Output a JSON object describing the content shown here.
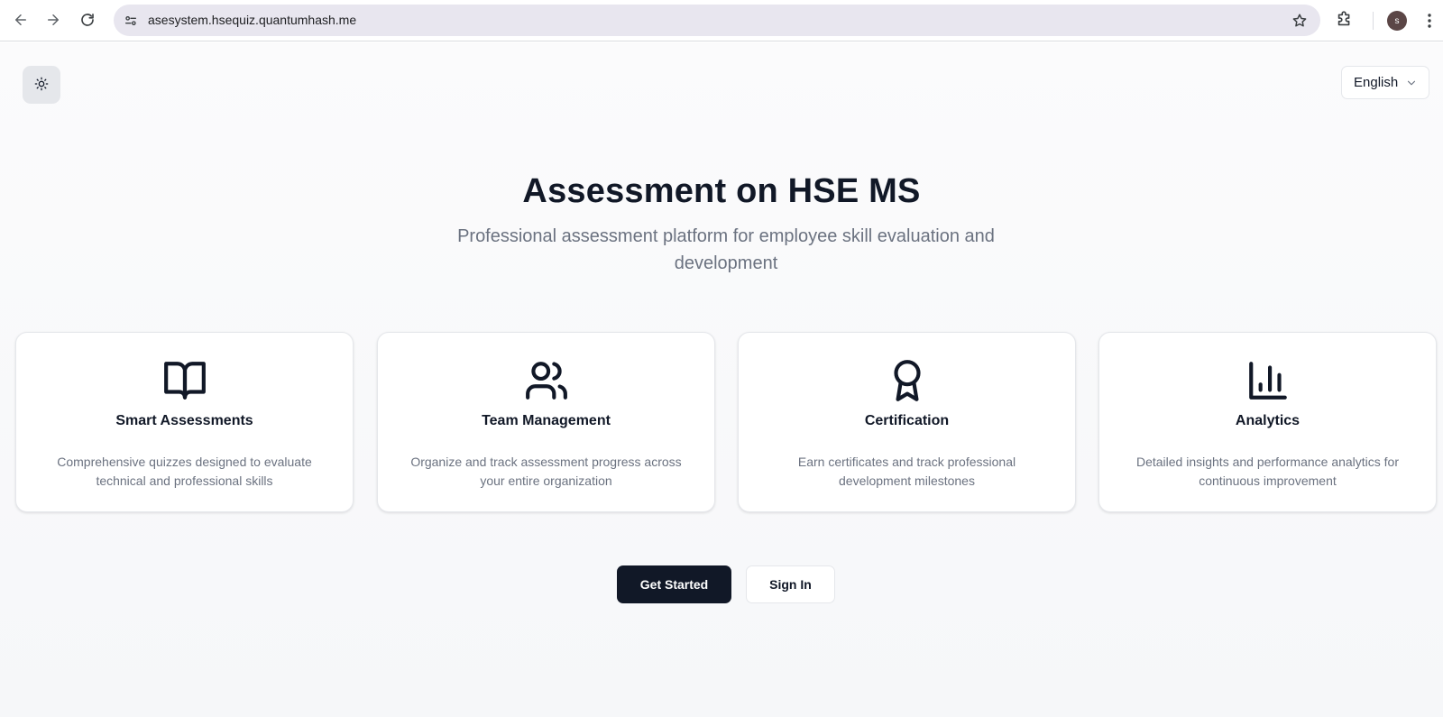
{
  "browser": {
    "url": "asesystem.hsequiz.quantumhash.me",
    "profile_initial": "s",
    "icons": {
      "back": "back-arrow-icon",
      "forward": "forward-arrow-icon",
      "reload": "reload-icon",
      "site_settings": "site-settings-icon",
      "bookmark": "star-icon",
      "extensions": "puzzle-icon",
      "menu": "kebab-menu-icon"
    }
  },
  "header": {
    "theme_toggle_icon": "sun-icon",
    "language": "English"
  },
  "hero": {
    "title": "Assessment on HSE MS",
    "subtitle": "Professional assessment platform for employee skill evaluation and development"
  },
  "features": [
    {
      "icon": "book-open-icon",
      "title": "Smart Assessments",
      "description": "Comprehensive quizzes designed to evaluate technical and professional skills"
    },
    {
      "icon": "users-icon",
      "title": "Team Management",
      "description": "Organize and track assessment progress across your entire organization"
    },
    {
      "icon": "award-icon",
      "title": "Certification",
      "description": "Earn certificates and track professional development milestones"
    },
    {
      "icon": "bar-chart-icon",
      "title": "Analytics",
      "description": "Detailed insights and performance analytics for continuous improvement"
    }
  ],
  "actions": {
    "primary": "Get Started",
    "secondary": "Sign In"
  },
  "colors": {
    "primary_button": "#111827",
    "text_muted": "#6b7280",
    "omnibox": "#e8e6ef"
  }
}
